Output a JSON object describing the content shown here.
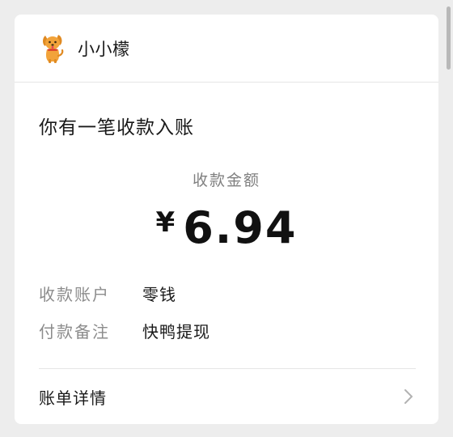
{
  "header": {
    "app_name": "小小檬",
    "avatar_icon": "dog-mascot-icon"
  },
  "notice": {
    "title": "你有一笔收款入账"
  },
  "amount": {
    "label": "收款金额",
    "currency_symbol": "¥",
    "value": "6.94"
  },
  "details": [
    {
      "label": "收款账户",
      "value": "零钱"
    },
    {
      "label": "付款备注",
      "value": "快鸭提现"
    }
  ],
  "footer": {
    "link_label": "账单详情",
    "link_icon": "chevron-right-icon"
  },
  "colors": {
    "background": "#ededed",
    "card": "#ffffff",
    "muted_text": "#8c8c8c",
    "primary_text": "#191919",
    "mascot_orange": "#f2a33a"
  }
}
